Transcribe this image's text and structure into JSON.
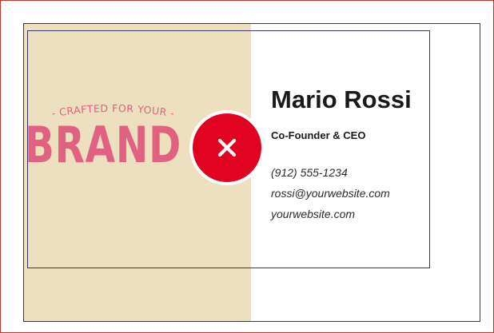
{
  "card": {
    "tagline": "- CRAFTED FOR YOUR -",
    "brand": "BRAND",
    "name": "Mario Rossi",
    "role": "Co-Founder & CEO",
    "phone": "(912) 555-1234",
    "email": "rossi@yourwebsite.com",
    "website": "yourwebsite.com"
  },
  "overlay": {
    "icon": "close-icon",
    "color": "#e0021f"
  },
  "colors": {
    "left_panel": "#ede0bf",
    "brand_pink": "#e06280",
    "frame_border": "#c0392b",
    "safe_area_border": "#3b3565"
  }
}
